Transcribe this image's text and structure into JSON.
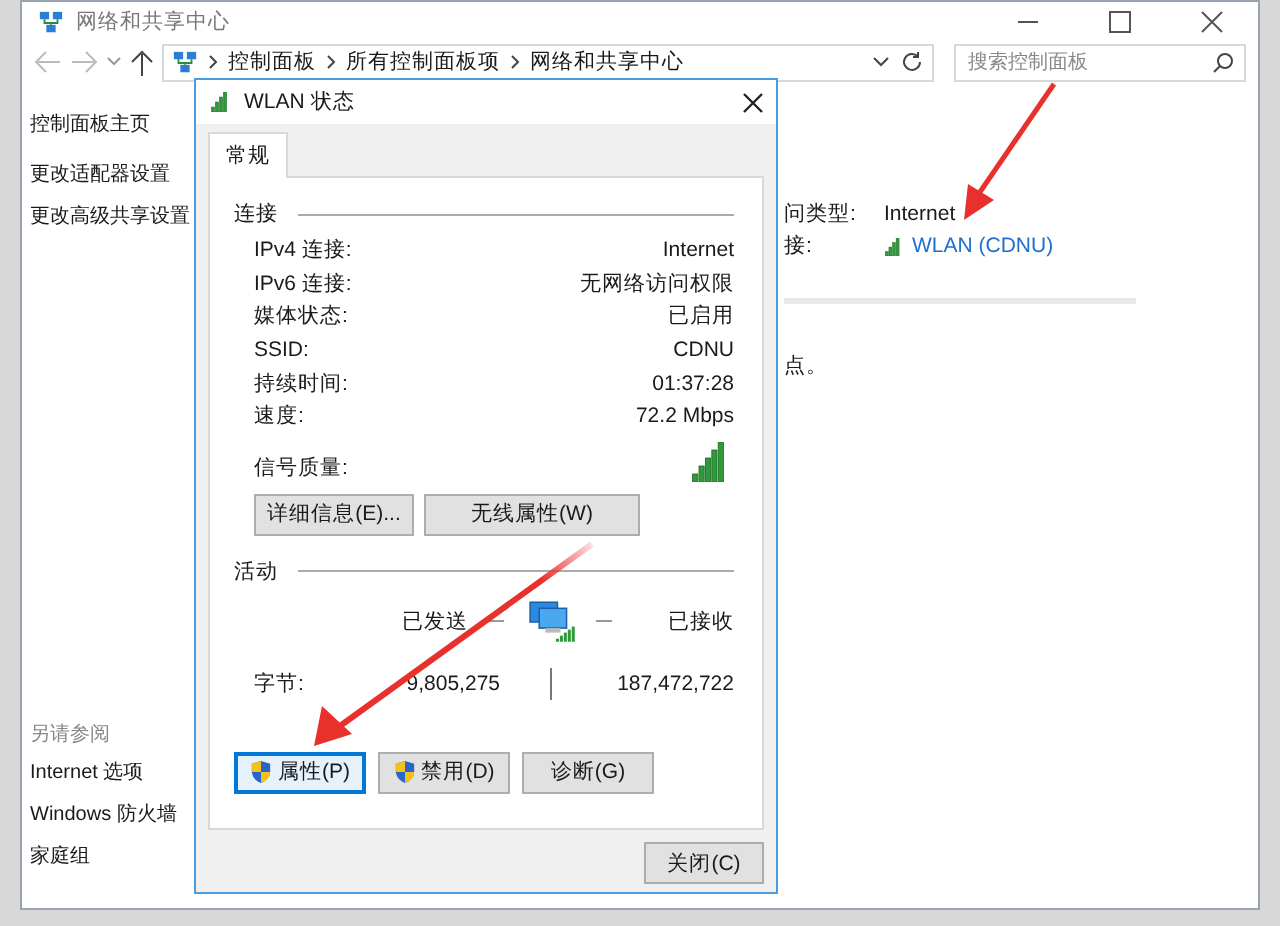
{
  "window": {
    "title": "网络和共享中心"
  },
  "nav": {
    "breadcrumb": [
      "控制面板",
      "所有控制面板项",
      "网络和共享中心"
    ],
    "search": {
      "placeholder": "搜索控制面板"
    }
  },
  "sidebar": {
    "items": [
      "控制面板主页",
      "更改适配器设置",
      "更改高级共享设置"
    ],
    "see_also_title": "另请参阅",
    "see_also": [
      "Internet 选项",
      "Windows 防火墙",
      "家庭组"
    ]
  },
  "main": {
    "rows": [
      {
        "label": "问类型:",
        "value": "Internet",
        "kind": "text"
      },
      {
        "label": "接:",
        "value": "WLAN (CDNU)",
        "kind": "link"
      }
    ],
    "note": "点。"
  },
  "dialog": {
    "title": "WLAN 状态",
    "tabs": [
      {
        "label": "常规",
        "selected": true
      }
    ],
    "connection": {
      "title": "连接",
      "rows": [
        {
          "label": "IPv4 连接:",
          "value": "Internet"
        },
        {
          "label": "IPv6 连接:",
          "value": "无网络访问权限"
        },
        {
          "label": "媒体状态:",
          "value": "已启用"
        },
        {
          "label": "SSID:",
          "value": "CDNU"
        },
        {
          "label": "持续时间:",
          "value": "01:37:28"
        },
        {
          "label": "速度:",
          "value": "72.2 Mbps"
        }
      ],
      "signal_label": "信号质量:",
      "buttons": [
        "详细信息(E)...",
        "无线属性(W)"
      ]
    },
    "activity": {
      "title": "活动",
      "sent_label": "已发送",
      "received_label": "已接收",
      "bytes_label": "字节:",
      "sent": "9,805,275",
      "received": "187,472,722"
    },
    "buttons": [
      {
        "label": "属性(P)",
        "kind": "shield",
        "focused": true
      },
      {
        "label": "禁用(D)",
        "kind": "shield",
        "focused": false
      },
      {
        "label": "诊断(G)",
        "kind": "plain",
        "focused": false
      }
    ],
    "close_button": "关闭(C)"
  }
}
